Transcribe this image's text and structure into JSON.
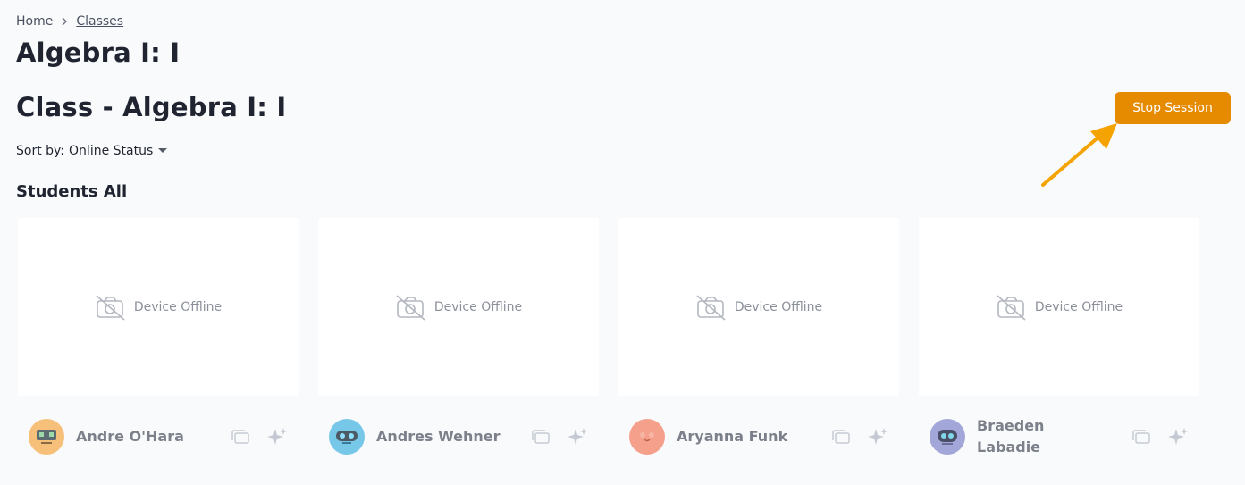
{
  "breadcrumb": {
    "home": "Home",
    "current": "Classes"
  },
  "page_title": "Algebra I: I",
  "class_title": "Class - Algebra I: I",
  "stop_session_label": "Stop Session",
  "sort": {
    "label": "Sort by:",
    "value": "Online Status"
  },
  "section_title": "Students All",
  "colors": {
    "accent": "#e68a00",
    "arrow": "#f5a300"
  },
  "students": [
    {
      "name": "Andre O'Hara",
      "status": "Device Offline",
      "avatar_color": "#f7c07a",
      "avatar_icon": "robot-avatar-icon"
    },
    {
      "name": "Andres Wehner",
      "status": "Device Offline",
      "avatar_color": "#76c7e8",
      "avatar_icon": "robot-avatar-icon"
    },
    {
      "name": "Aryanna Funk",
      "status": "Device Offline",
      "avatar_color": "#f5a08a",
      "avatar_icon": "smile-avatar-icon"
    },
    {
      "name": "Braeden Labadie",
      "status": "Device Offline",
      "avatar_color": "#a2a6d8",
      "avatar_icon": "robot-avatar-icon"
    }
  ]
}
